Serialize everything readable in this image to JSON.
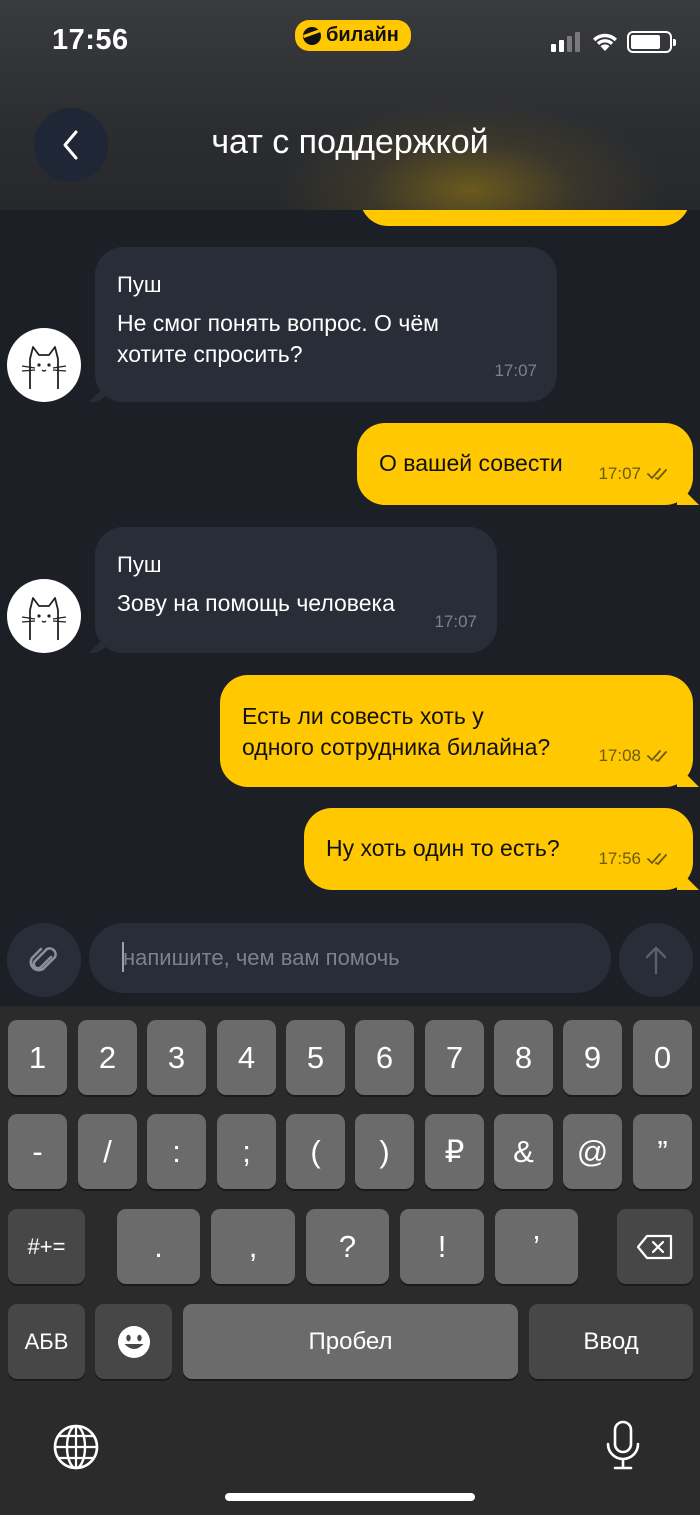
{
  "status_bar": {
    "time": "17:56",
    "carrier": "билайн"
  },
  "header": {
    "title": "чат с поддержкой"
  },
  "messages": [
    {
      "direction": "in",
      "author": "Пуш",
      "lines": [
        "Не смог понять вопрос. О чём",
        "хотите спросить?"
      ],
      "time": "17:07"
    },
    {
      "direction": "out",
      "text": "О вашей совести",
      "time": "17:07"
    },
    {
      "direction": "in",
      "author": "Пуш",
      "lines": [
        "Зову на помощь человека"
      ],
      "time": "17:07"
    },
    {
      "direction": "out",
      "lines": [
        "Есть ли совесть хоть у",
        "одного сотрудника билайна?"
      ],
      "time": "17:08"
    },
    {
      "direction": "out",
      "text": "Ну хоть один то есть?",
      "time": "17:56"
    }
  ],
  "composer": {
    "placeholder": "напишите, чем вам помочь"
  },
  "keyboard": {
    "row1": [
      "1",
      "2",
      "3",
      "4",
      "5",
      "6",
      "7",
      "8",
      "9",
      "0"
    ],
    "row2": [
      "-",
      "/",
      ":",
      ";",
      "(",
      ")",
      "₽",
      "&",
      "@",
      "”"
    ],
    "row3": {
      "mode": "#+=",
      "keys": [
        ".",
        ",",
        "?",
        "!",
        "’"
      ]
    },
    "row4": {
      "lang": "АБВ",
      "space": "Пробел",
      "enter": "Ввод"
    }
  },
  "colors": {
    "accent": "#ffc800",
    "background": "#1c1f26",
    "bubble_in": "#292d37"
  }
}
